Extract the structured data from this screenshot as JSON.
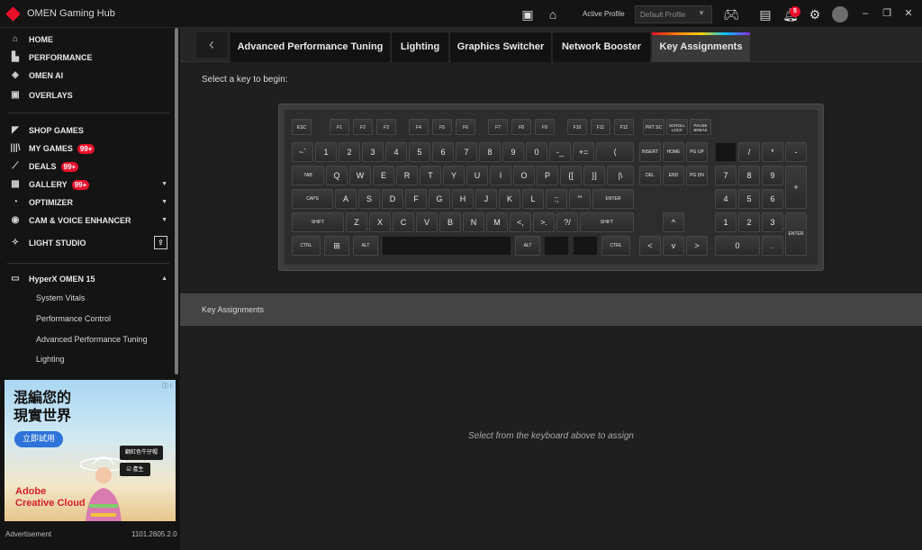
{
  "titlebar": {
    "app_title": "OMEN Gaming Hub",
    "active_profile_label": "Active Profile",
    "profile_value": "Default Profile",
    "notification_count": "5"
  },
  "sidebar": {
    "items": [
      {
        "label": "HOME",
        "icon": "home-icon"
      },
      {
        "label": "PERFORMANCE",
        "icon": "performance-icon"
      },
      {
        "label": "OMEN AI",
        "icon": "omen-ai-icon"
      },
      {
        "label": "OVERLAYS",
        "icon": "overlays-icon"
      },
      {
        "label": "SHOP GAMES",
        "icon": "shop-icon"
      },
      {
        "label": "MY GAMES",
        "icon": "library-icon",
        "badge": "99+"
      },
      {
        "label": "DEALS",
        "icon": "deals-icon",
        "badge": "99+"
      },
      {
        "label": "GALLERY",
        "icon": "gallery-icon",
        "badge": "99+"
      },
      {
        "label": "OPTIMIZER",
        "icon": "optimizer-icon"
      },
      {
        "label": "CAM & VOICE ENHANCER",
        "icon": "cam-voice-icon"
      },
      {
        "label": "LIGHT STUDIO",
        "icon": "light-studio-icon"
      }
    ],
    "device": {
      "label": "HyperX OMEN 15",
      "sub_items": [
        "System Vitals",
        "Performance Control",
        "Advanced Performance Tuning",
        "Lighting"
      ]
    }
  },
  "ad": {
    "title": "混編您的\n現實世界",
    "cta": "立即試用",
    "chip1": "翻紅色牛仔帽",
    "chip2": "☑ 產生",
    "brand": "Adobe\nCreative Cloud",
    "info": "ⓘ ⁝",
    "label": "Advertisement"
  },
  "version": "1101.2605.2.0",
  "tabs": [
    "Advanced Performance Tuning",
    "Lighting",
    "Graphics Switcher",
    "Network Booster",
    "Key Assignments"
  ],
  "active_tab": "Key Assignments",
  "main": {
    "prompt": "Select a key to begin:",
    "assign_header": "Key Assignments",
    "empty_message": "Select from the keyboard above to assign"
  },
  "keyboard": {
    "fn_row": [
      "ESC",
      "F1",
      "F2",
      "F3",
      "F4",
      "F5",
      "F6",
      "F7",
      "F8",
      "F9",
      "F10",
      "F11",
      "F12"
    ],
    "special_row": [
      "PRT SC",
      "SCROLL LOCK",
      "PAUSE BREAK"
    ],
    "num_row": [
      "~`",
      "1",
      "2",
      "3",
      "4",
      "5",
      "6",
      "7",
      "8",
      "9",
      "0",
      "-_",
      "+=",
      "⟨"
    ],
    "top_row": [
      "TAB",
      "Q",
      "W",
      "E",
      "R",
      "T",
      "Y",
      "U",
      "I",
      "O",
      "P",
      "{[",
      "}]",
      "|\\"
    ],
    "home_row": [
      "CAPS",
      "A",
      "S",
      "D",
      "F",
      "G",
      "H",
      "J",
      "K",
      "L",
      ":;",
      "\"'",
      "ENTER"
    ],
    "shift_row": [
      "SHIFT",
      "Z",
      "X",
      "C",
      "V",
      "B",
      "N",
      "M",
      "<,",
      ">.",
      "?/",
      "SHIFT"
    ],
    "bottom_row": [
      "CTRL",
      "⊞",
      "ALT",
      "",
      "ALT",
      "",
      "",
      "CTRL"
    ],
    "nav_cluster": [
      "INSERT",
      "HOME",
      "PG UP",
      "DEL",
      "END",
      "PG DN"
    ],
    "arrows": [
      "^",
      "<",
      "v",
      ">"
    ],
    "numpad": [
      "",
      "/",
      "*",
      "-",
      "7",
      "8",
      "9",
      "+",
      "4",
      "5",
      "6",
      "1",
      "2",
      "3",
      "ENTER",
      "0",
      "."
    ]
  }
}
